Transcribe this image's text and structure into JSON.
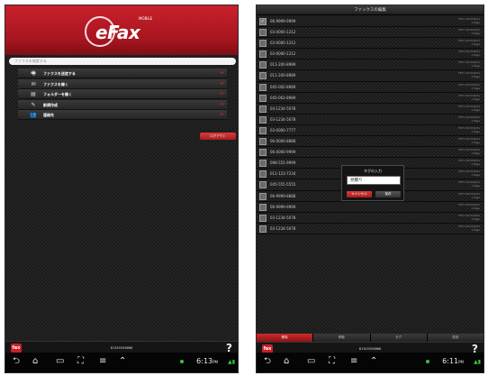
{
  "left": {
    "logo": "eFax",
    "logo_tm": "MOBILE",
    "search_placeholder": "ファクスを検索する",
    "menu": [
      {
        "label": "ファクスを送信する",
        "icon": "fax-send-icon",
        "glyph": "🖷"
      },
      {
        "label": "ファクスを開く",
        "icon": "fax-inbox-icon",
        "glyph": "✉"
      },
      {
        "label": "フォルダーを開く",
        "icon": "folder-icon",
        "glyph": "▤"
      },
      {
        "label": "新規作成",
        "icon": "pen-icon",
        "glyph": "✎"
      },
      {
        "label": "連絡先",
        "icon": "contacts-icon",
        "glyph": "👥"
      }
    ],
    "arrow": "»»",
    "logout_label": "ログアウト",
    "fax_number": "81345556666",
    "help": "?",
    "app_icon_text": "fax"
  },
  "right": {
    "title": "ファックスの編集",
    "rows": [
      {
        "number": "06-9999-9999",
        "checked": true,
        "meta1": "TEXT 2013/04/01",
        "meta2": "1 Page"
      },
      {
        "number": "03-0000-1212",
        "checked": false,
        "meta1": "TEXT 2013/04/01",
        "meta2": "1 Page"
      },
      {
        "number": "03-0000-1212",
        "checked": false,
        "meta1": "TEXT 2013/04/01",
        "meta2": "1 Page"
      },
      {
        "number": "03-0000-1212",
        "checked": false,
        "meta1": "TEXT 2013/04/01",
        "meta2": "1 Page"
      },
      {
        "number": "011-200-8989",
        "checked": false,
        "meta1": "TEXT 2013/04/01",
        "meta2": "1 Page"
      },
      {
        "number": "011-200-8989",
        "checked": false,
        "meta1": "TEXT 2013/04/01",
        "meta2": "1 Page"
      },
      {
        "number": "045-002-8989",
        "checked": false,
        "meta1": "TEXT 2013/04/01",
        "meta2": "1 Page"
      },
      {
        "number": "045-002-8989",
        "checked": false,
        "meta1": "TEXT 2013/04/01",
        "meta2": "1 Page"
      },
      {
        "number": "03-1234-5678",
        "checked": false,
        "meta1": "TEXT 2013/04/01",
        "meta2": "1 Page"
      },
      {
        "number": "03-1234-5678",
        "checked": false,
        "meta1": "TEXT 2013/04/01",
        "meta2": "1 Page"
      },
      {
        "number": "03-0000-7777",
        "checked": false,
        "meta1": "TEXT 2013/04/01",
        "meta2": "1 Page"
      },
      {
        "number": "06-0000-8888",
        "checked": false,
        "meta1": "TEXT 2013/04/01",
        "meta2": "1 Page"
      },
      {
        "number": "06-0000-9999",
        "checked": false,
        "meta1": "TEXT 2013/04/01",
        "meta2": "1 Page"
      },
      {
        "number": "098-555-9999",
        "checked": false,
        "meta1": "TEXT 2013/04/01",
        "meta2": "1 Page"
      },
      {
        "number": "011-123-7234",
        "checked": false,
        "meta1": "TEXT 2013/04/01",
        "meta2": "1 Page"
      },
      {
        "number": "045-555-5555",
        "checked": false,
        "meta1": "TEXT 2013/04/01",
        "meta2": "1 Page"
      },
      {
        "number": "06-9999-8888",
        "checked": false,
        "meta1": "TEXT 2013/04/01",
        "meta2": "1 Page"
      },
      {
        "number": "06-9999-9999",
        "checked": false,
        "meta1": "TEXT 2013/04/01",
        "meta2": "1 Page"
      },
      {
        "number": "03-1234-5678",
        "checked": false,
        "meta1": "TEXT 2013/04/01",
        "meta2": "1 Page"
      },
      {
        "number": "03-1234-5678",
        "checked": false,
        "meta1": "TEXT 2013/04/01",
        "meta2": "1 Page"
      }
    ],
    "dialog": {
      "title": "タグの入力",
      "value": "見積り",
      "cancel": "キャンセル",
      "ok": "保存"
    },
    "tabs": [
      "削除",
      "移動",
      "タグ",
      "既読"
    ],
    "fax_number": "81345556666",
    "help": "?",
    "app_icon_text": "fax"
  },
  "system_bar": {
    "left_time": "6:13",
    "left_ampm": "PM",
    "right_time": "6:11",
    "right_ampm": "PM",
    "nav": [
      "⮌",
      "⌂",
      "▭",
      "⛶",
      "≡",
      "⌃"
    ]
  }
}
